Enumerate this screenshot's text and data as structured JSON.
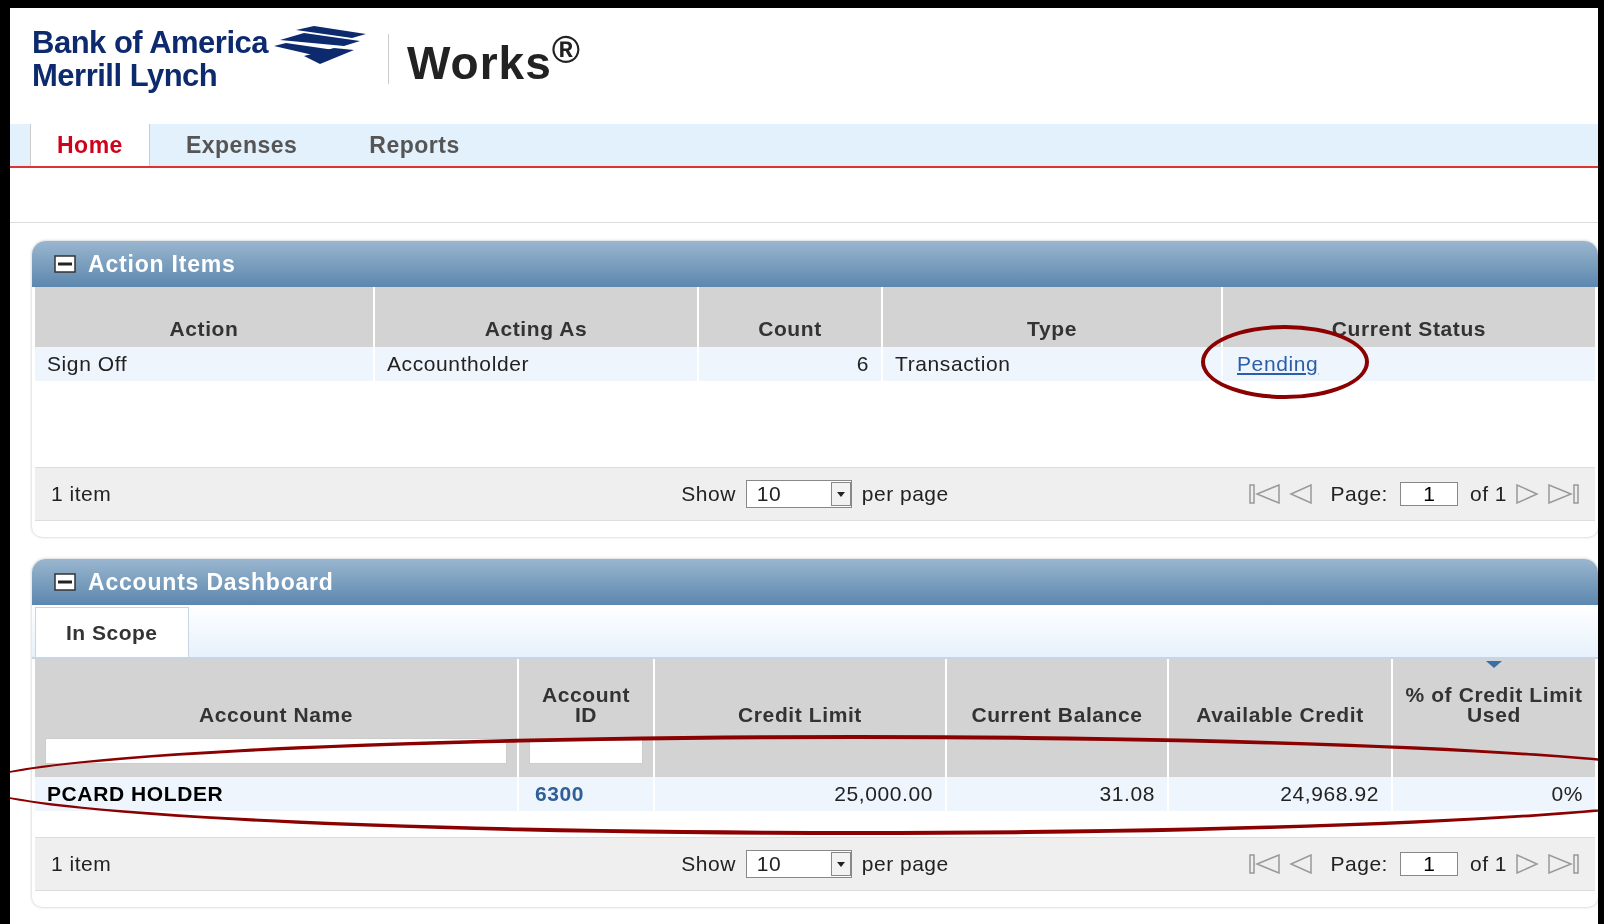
{
  "header": {
    "brand_lines": [
      "Bank of America",
      "Merrill Lynch"
    ],
    "product": "Works$^{®}$"
  },
  "nav": {
    "tabs": [
      {
        "label": "Home",
        "selected": true
      },
      {
        "label": "Expenses",
        "selected": false
      },
      {
        "label": "Reports",
        "selected": false
      }
    ]
  },
  "action_items": {
    "title": "Action Items",
    "expanded": true,
    "columns": [
      {
        "label": "Action"
      },
      {
        "label": "Acting As"
      },
      {
        "label": "Count"
      },
      {
        "label": "Type"
      },
      {
        "label": "Current Status"
      }
    ],
    "rows": [
      {
        "cells": [
          {
            "kind": "text",
            "text": "Sign Off",
            "circled": false
          },
          {
            "kind": "text",
            "text": "Accountholder",
            "circled": false
          },
          {
            "kind": "number",
            "text": "6",
            "circled": false
          },
          {
            "kind": "text",
            "text": "Transaction",
            "circled": false
          },
          {
            "kind": "link",
            "text": "Pending",
            "circled": true
          }
        ]
      }
    ],
    "pager": {
      "count": "1 item",
      "show": "Show",
      "page_size": "10",
      "per_page": "per page",
      "page_label": "Page:",
      "page": "1",
      "of": "of 1"
    }
  },
  "accounts_dashboard": {
    "title": "Accounts Dashboard",
    "expanded": true,
    "tabs": [
      {
        "label": "In Scope",
        "selected": true
      }
    ],
    "columns": [
      {
        "label": "Account Name",
        "filter": true,
        "sorted": false
      },
      {
        "label": "Account ID",
        "filter": true,
        "sorted": false
      },
      {
        "label": "Credit Limit",
        "filter": false,
        "sorted": false
      },
      {
        "label": "Current Balance",
        "filter": false,
        "sorted": false
      },
      {
        "label": "Available Credit",
        "filter": false,
        "sorted": false
      },
      {
        "label": "% of Credit Limit Used",
        "filter": false,
        "sorted": true
      }
    ],
    "rows": [
      {
        "circled": true,
        "cells": [
          {
            "kind": "strong",
            "text": "PCARD HOLDER"
          },
          {
            "kind": "id",
            "text": "6300"
          },
          {
            "kind": "number",
            "text": "25,000.00"
          },
          {
            "kind": "number",
            "text": "31.08"
          },
          {
            "kind": "number",
            "text": "24,968.92"
          },
          {
            "kind": "number",
            "text": "0%"
          }
        ]
      }
    ],
    "pager": {
      "count": "1 item",
      "show": "Show",
      "page_size": "10",
      "per_page": "per page",
      "page_label": "Page:",
      "page": "1",
      "of": "of 1"
    }
  }
}
